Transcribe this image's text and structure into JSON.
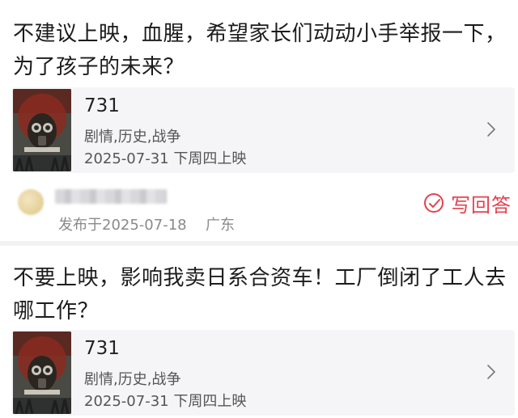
{
  "posts": [
    {
      "text": "不建议上映，血腥，希望家长们动动小手举报一下，为了孩子的未来？",
      "movie": {
        "title": "731",
        "genre": "剧情,历史,战争",
        "release": "2025-07-31 下周四上映",
        "poster_icon": "movie-poster"
      },
      "author": {
        "avatar_icon": "blurred-avatar",
        "name_hidden": true,
        "posted_at": "发布于2025-07-18",
        "location": "广东"
      },
      "action": {
        "label": "写回答",
        "icon": "edit-circle-icon",
        "color": "#e5424d"
      }
    },
    {
      "text": "不要上映，影响我卖日系合资车！工厂倒闭了工人去哪工作？",
      "movie": {
        "title": "731",
        "genre": "剧情,历史,战争",
        "release": "2025-07-31 下周四上映",
        "poster_icon": "movie-poster"
      }
    }
  ],
  "colors": {
    "accent": "#e5424d",
    "card_bg": "#f5f5f7",
    "muted_text": "#8a8a8a"
  }
}
